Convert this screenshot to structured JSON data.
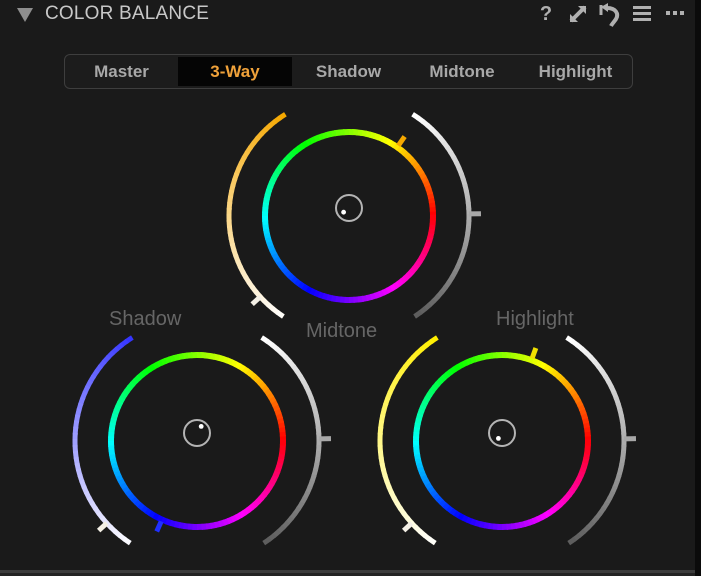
{
  "panel": {
    "title": "COLOR BALANCE",
    "header_icons": [
      {
        "name": "help-icon",
        "glyph": "?"
      },
      {
        "name": "expand-icon",
        "glyph": "⤢"
      },
      {
        "name": "reset-icon",
        "glyph": "↶"
      },
      {
        "name": "menu-icon",
        "glyph": "≡"
      },
      {
        "name": "more-icon",
        "glyph": "···"
      }
    ]
  },
  "tabs": [
    {
      "label": "Master",
      "active": false
    },
    {
      "label": "3-Way",
      "active": true
    },
    {
      "label": "Shadow",
      "active": false
    },
    {
      "label": "Midtone",
      "active": false
    },
    {
      "label": "Highlight",
      "active": false
    }
  ],
  "colors": {
    "active_tab": "#f0a23a",
    "background": "#1a1a1a",
    "label": "#666666"
  },
  "wheels": [
    {
      "id": "midtone",
      "label": "Midtone",
      "hue_marker_deg": 55,
      "hue_marker_color": "#f5a800",
      "saturation_arc_top_color": "#f5a800",
      "saturation_level": 0.12,
      "luminance_level": 0.5,
      "puck_offset": {
        "dx": -0.45,
        "dy": 0.35
      }
    },
    {
      "id": "shadow",
      "label": "Shadow",
      "hue_marker_deg": 246,
      "hue_marker_color": "#2030ff",
      "saturation_arc_top_color": "#3535ff",
      "saturation_level": 0.12,
      "luminance_level": 0.5,
      "puck_offset": {
        "dx": 0.35,
        "dy": -0.55
      }
    },
    {
      "id": "highlight",
      "label": "Highlight",
      "hue_marker_deg": 70,
      "hue_marker_color": "#f0e000",
      "saturation_arc_top_color": "#ffee00",
      "saturation_level": 0.12,
      "luminance_level": 0.5,
      "puck_offset": {
        "dx": -0.3,
        "dy": 0.45
      }
    }
  ]
}
